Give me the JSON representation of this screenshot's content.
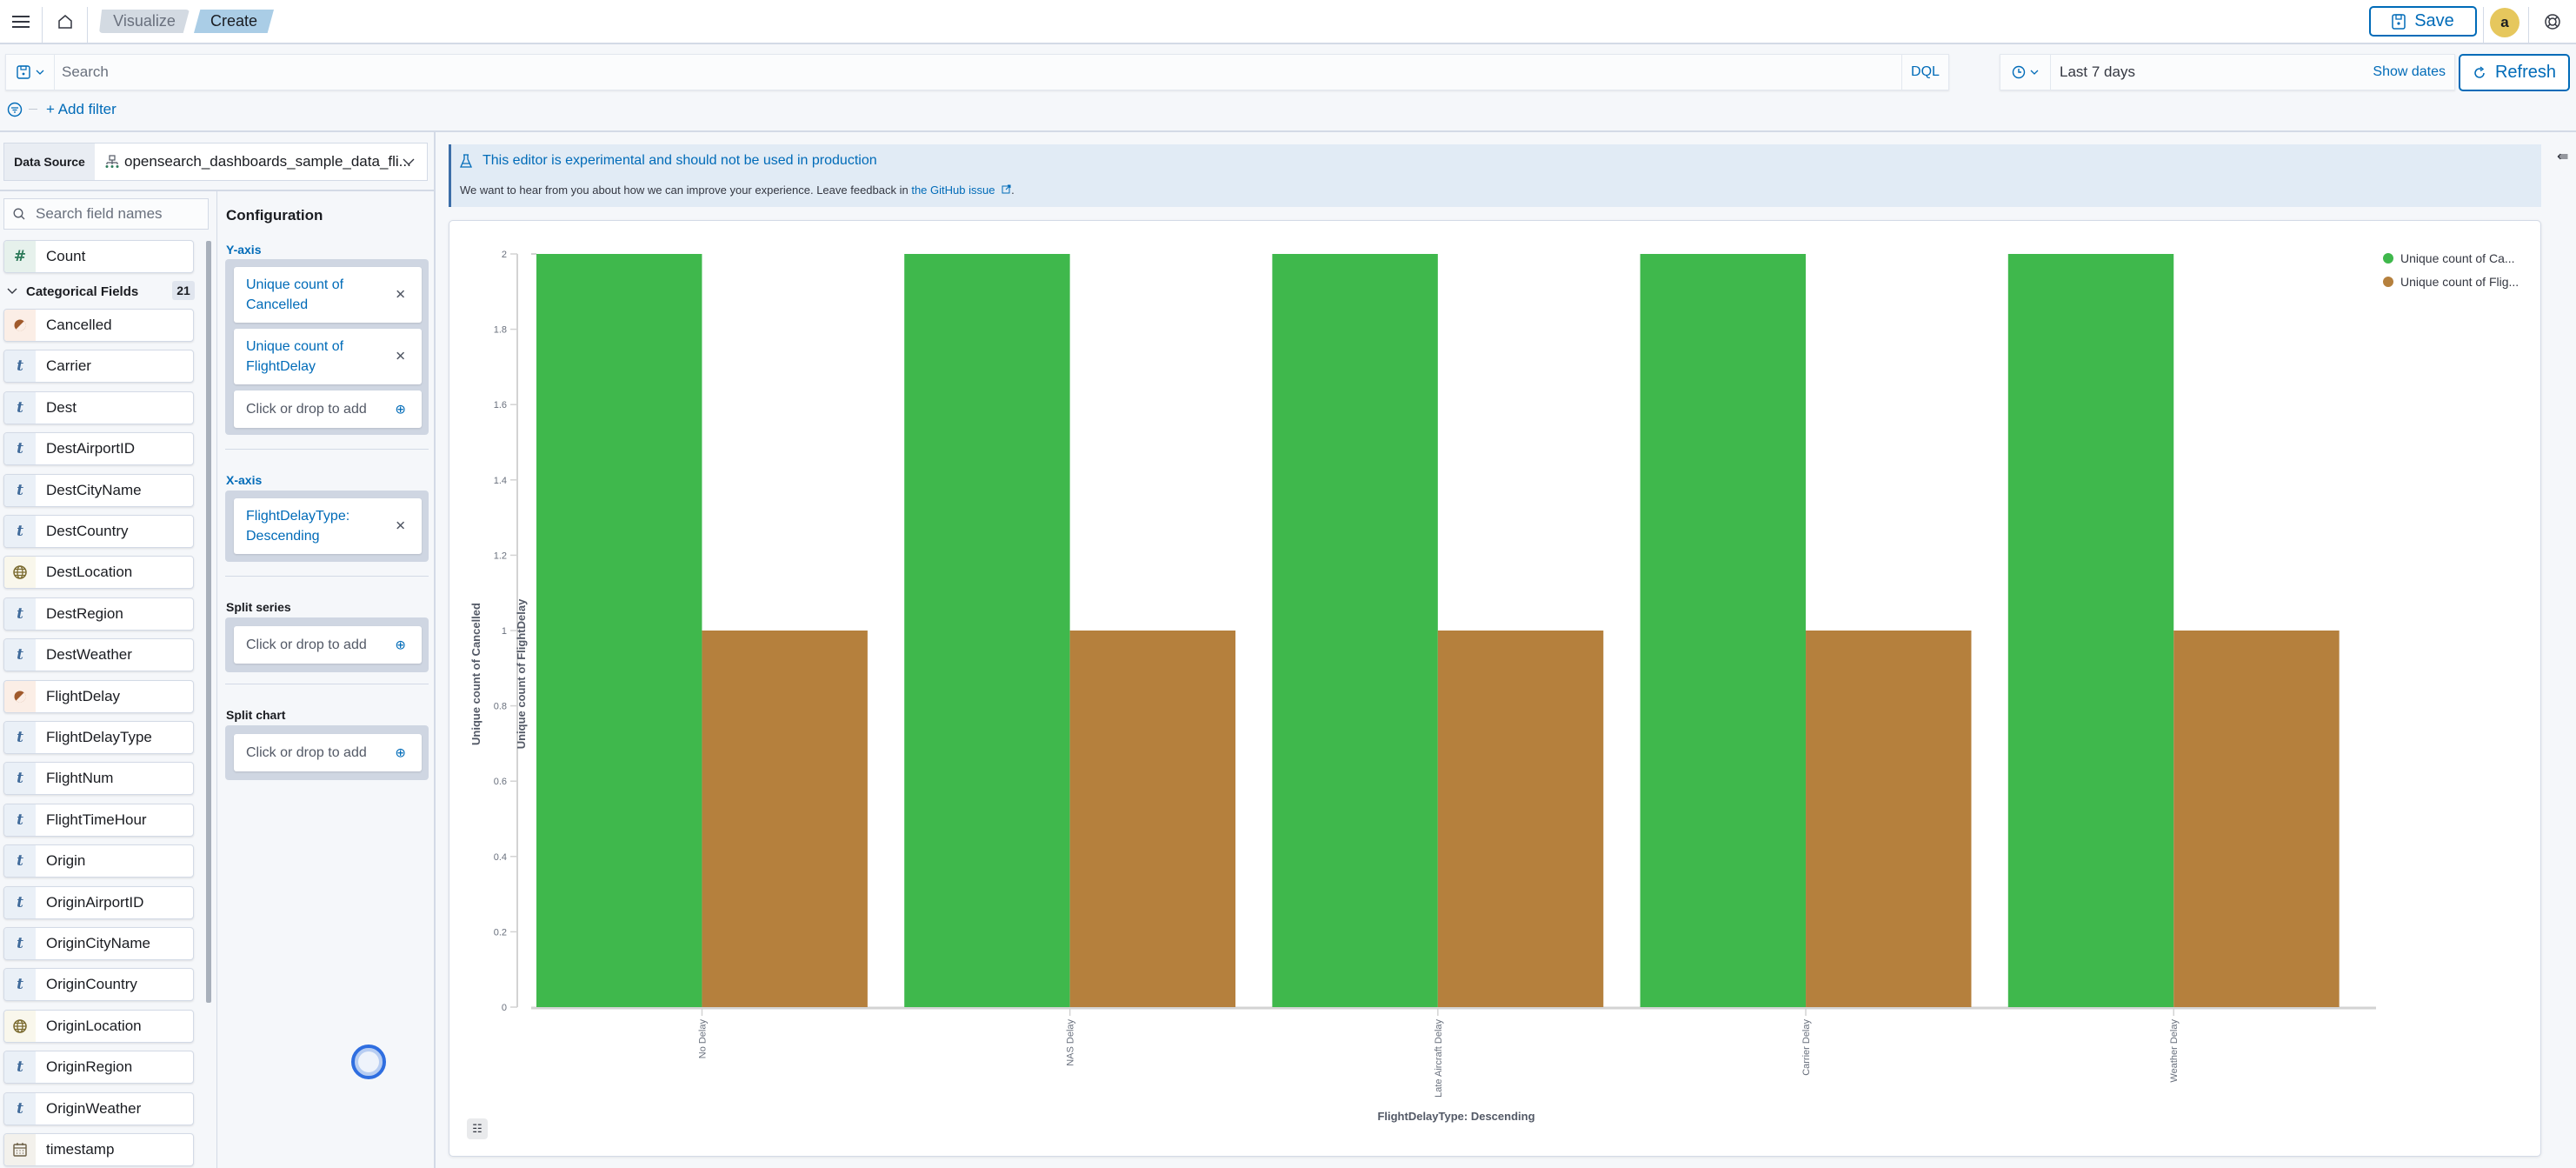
{
  "header": {
    "breadcrumbs": [
      "Visualize",
      "Create"
    ],
    "save_label": "Save",
    "avatar_initial": "a",
    "icons": {
      "menu": "hamburger-icon",
      "home": "home-icon",
      "help": "help-lifebuoy-icon",
      "save": "save-disk-icon"
    }
  },
  "query": {
    "search_placeholder": "Search",
    "language": "DQL",
    "date_range": "Last 7 days",
    "show_dates": "Show dates",
    "refresh_label": "Refresh",
    "add_filter": "+ Add filter"
  },
  "data_source": {
    "label": "Data Source",
    "value": "opensearch_dashboards_sample_data_fli..."
  },
  "fields": {
    "search_placeholder": "Search field names",
    "count_field": {
      "name": "Count",
      "type": "number"
    },
    "categorical_header": "Categorical Fields",
    "categorical_count": "21",
    "categorical": [
      {
        "name": "Cancelled",
        "type": "boolean"
      },
      {
        "name": "Carrier",
        "type": "string"
      },
      {
        "name": "Dest",
        "type": "string"
      },
      {
        "name": "DestAirportID",
        "type": "string"
      },
      {
        "name": "DestCityName",
        "type": "string"
      },
      {
        "name": "DestCountry",
        "type": "string"
      },
      {
        "name": "DestLocation",
        "type": "geo"
      },
      {
        "name": "DestRegion",
        "type": "string"
      },
      {
        "name": "DestWeather",
        "type": "string"
      },
      {
        "name": "FlightDelay",
        "type": "boolean"
      },
      {
        "name": "FlightDelayType",
        "type": "string"
      },
      {
        "name": "FlightNum",
        "type": "string"
      },
      {
        "name": "FlightTimeHour",
        "type": "string"
      },
      {
        "name": "Origin",
        "type": "string"
      },
      {
        "name": "OriginAirportID",
        "type": "string"
      },
      {
        "name": "OriginCityName",
        "type": "string"
      },
      {
        "name": "OriginCountry",
        "type": "string"
      },
      {
        "name": "OriginLocation",
        "type": "geo"
      },
      {
        "name": "OriginRegion",
        "type": "string"
      },
      {
        "name": "OriginWeather",
        "type": "string"
      },
      {
        "name": "timestamp",
        "type": "date"
      }
    ]
  },
  "config": {
    "title": "Configuration",
    "y_axis": {
      "label": "Y-axis",
      "items": [
        "Unique count of Cancelled",
        "Unique count of FlightDelay"
      ],
      "add": "Click or drop to add"
    },
    "x_axis": {
      "label": "X-axis",
      "items": [
        "FlightDelayType: Descending"
      ]
    },
    "split_series": {
      "label": "Split series",
      "add": "Click or drop to add"
    },
    "split_chart": {
      "label": "Split chart",
      "add": "Click or drop to add"
    }
  },
  "callout": {
    "title": "This editor is experimental and should not be used in production",
    "body": "We want to hear from you about how we can improve your experience. Leave feedback in ",
    "link": "the GitHub issue",
    "end": "."
  },
  "chart_data": {
    "type": "bar",
    "title": "",
    "xlabel": "FlightDelayType: Descending",
    "ylabel": [
      "Unique count of Cancelled",
      "Unique count of FlightDelay"
    ],
    "categories": [
      "No Delay",
      "NAS Delay",
      "Late Aircraft Delay",
      "Carrier Delay",
      "Weather Delay"
    ],
    "series": [
      {
        "name": "Unique count of Cancelled",
        "legend_label": "Unique count of Ca...",
        "color": "#3fb84c",
        "values": [
          2,
          2,
          2,
          2,
          2
        ]
      },
      {
        "name": "Unique count of FlightDelay",
        "legend_label": "Unique count of Flig...",
        "color": "#b5803d",
        "values": [
          1,
          1,
          1,
          1,
          1
        ]
      }
    ],
    "ylim": [
      0,
      2
    ],
    "yticks": [
      0,
      0.2,
      0.4,
      0.6,
      0.8,
      1,
      1.2,
      1.4,
      1.6,
      1.8,
      2
    ],
    "grid": false,
    "legend": "top-right"
  }
}
